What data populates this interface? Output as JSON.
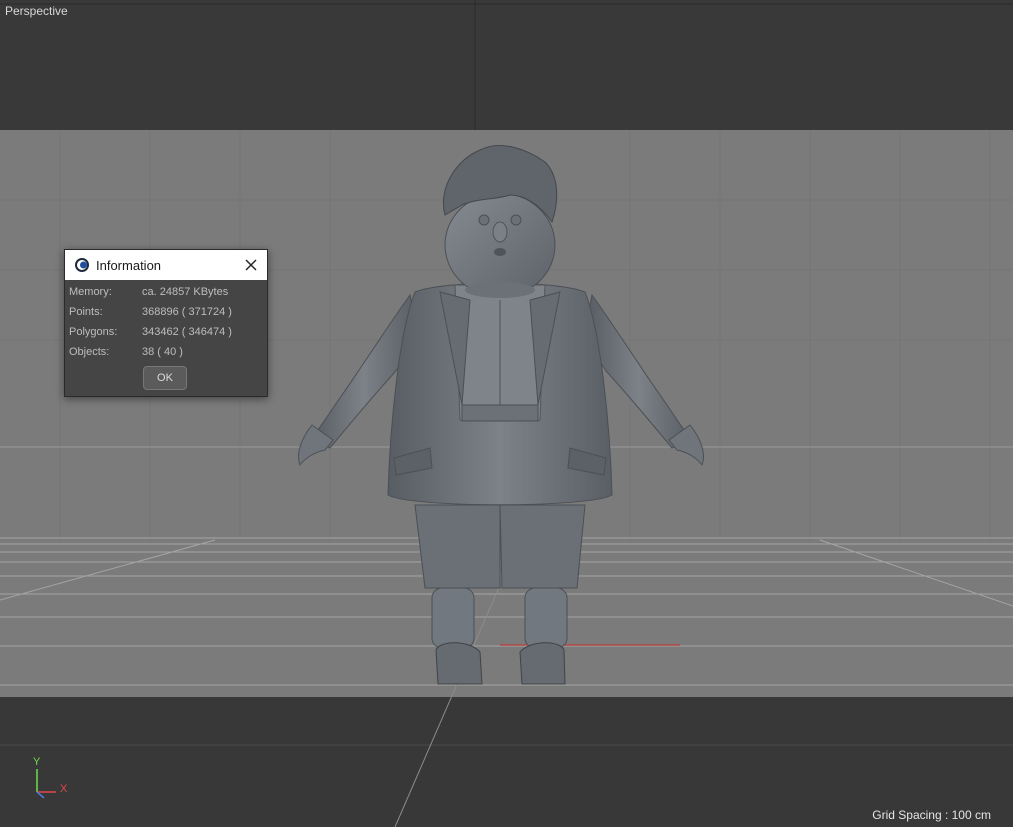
{
  "viewport": {
    "label": "Perspective",
    "grid_spacing": "Grid Spacing : 100 cm",
    "axis": {
      "y": "Y",
      "x": "X"
    }
  },
  "dialog": {
    "title": "Information",
    "rows": [
      {
        "label": "Memory:",
        "value": "ca. 24857 KBytes"
      },
      {
        "label": "Points:",
        "value": "368896 ( 371724 )"
      },
      {
        "label": "Polygons:",
        "value": "343462 ( 346474 )"
      },
      {
        "label": "Objects:",
        "value": "38 ( 40 )"
      }
    ],
    "ok_label": "OK"
  },
  "colors": {
    "floor_band": "#7d7d7d",
    "dark_band": "#383838",
    "axis_y": "#6fdc4e",
    "axis_x": "#e04848"
  }
}
